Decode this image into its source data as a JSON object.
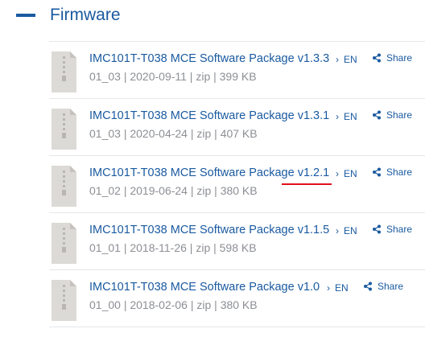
{
  "section": {
    "title": "Firmware",
    "accent_color": "#1a5aa0"
  },
  "items": [
    {
      "title": "IMC101T-T038 MCE Software Package v1.3.3",
      "meta": "01_03 | 2020-09-11 | zip | 399 KB",
      "language": "EN",
      "share_label": "Share",
      "icon": "zip-file-icon"
    },
    {
      "title": "IMC101T-T038 MCE Software Package v1.3.1",
      "meta": "01_03 | 2020-04-24 | zip | 407 KB",
      "language": "EN",
      "share_label": "Share",
      "icon": "zip-file-icon"
    },
    {
      "title": "IMC101T-T038 MCE Software Package v1.2.1",
      "meta": "01_02 | 2019-06-24 | zip | 380 KB",
      "language": "EN",
      "share_label": "Share",
      "icon": "zip-file-icon",
      "version_underlined": true,
      "underline_color": "#e0101a"
    },
    {
      "title": "IMC101T-T038 MCE Software Package v1.1.5",
      "meta": "01_01 | 2018-11-26 | zip | 598 KB",
      "language": "EN",
      "share_label": "Share",
      "icon": "zip-file-icon"
    },
    {
      "title": "IMC101T-T038 MCE Software Package v1.0",
      "meta": "01_00 | 2018-02-06 | zip | 380 KB",
      "language": "EN",
      "share_label": "Share",
      "icon": "zip-file-icon"
    }
  ]
}
